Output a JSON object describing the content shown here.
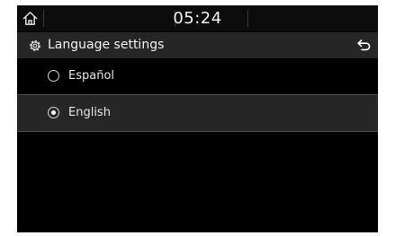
{
  "status_bar": {
    "home_icon": "home-icon",
    "time": "05:24"
  },
  "header": {
    "settings_icon": "gear-icon",
    "title": "Language settings",
    "back_icon": "back-arrow-icon"
  },
  "languages": {
    "items": [
      {
        "label": "Español",
        "selected": false
      },
      {
        "label": "English",
        "selected": true
      }
    ]
  }
}
